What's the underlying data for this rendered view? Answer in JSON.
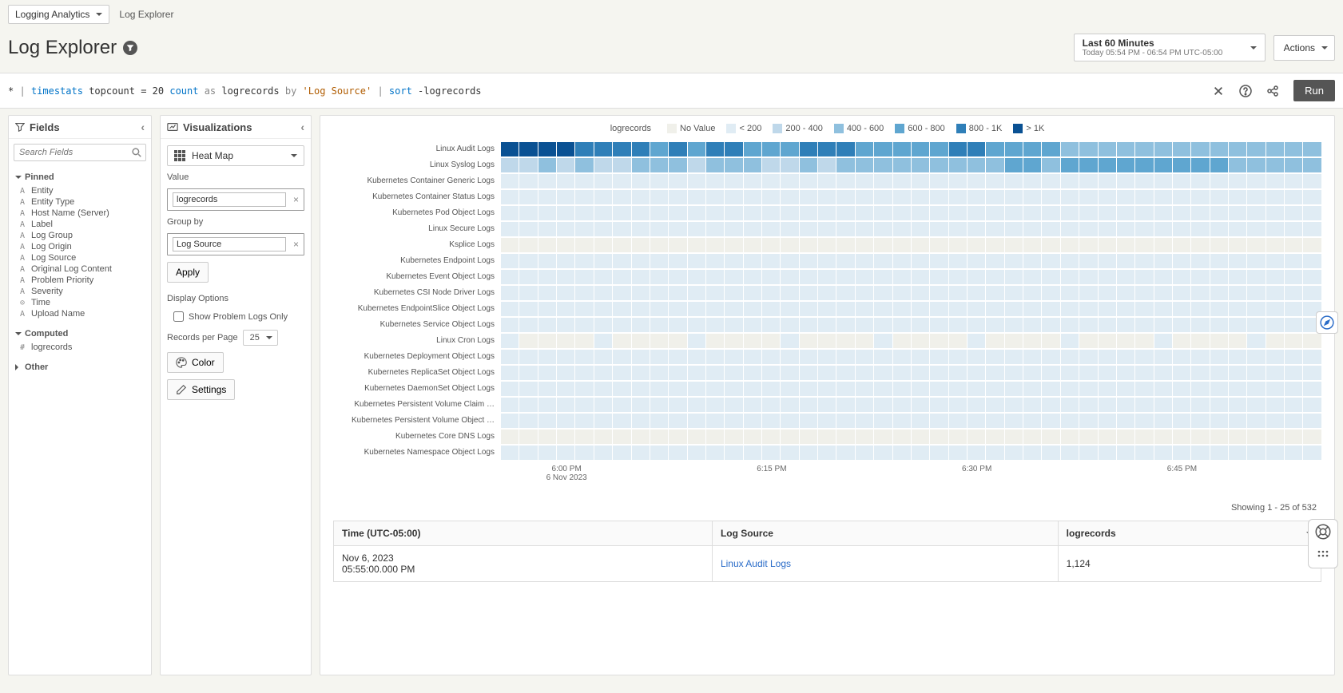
{
  "nav": {
    "dropdown": "Logging Analytics",
    "breadcrumb": "Log Explorer"
  },
  "title": "Log Explorer",
  "timerange": {
    "label": "Last 60 Minutes",
    "sub": "Today 05:54 PM - 06:54 PM UTC-05:00"
  },
  "actions_label": "Actions",
  "query": {
    "star": "*",
    "pipe1": "|",
    "cmd1": "timestats",
    "topcount": " topcount = 20 ",
    "count": "count",
    "as": " as ",
    "logrecords": "logrecords",
    "by": " by ",
    "source": "'Log Source'",
    "pipe2": " | ",
    "sort": "sort",
    "sortarg": " -logrecords"
  },
  "run_label": "Run",
  "fields": {
    "header": "Fields",
    "search_placeholder": "Search Fields",
    "pinned_label": "Pinned",
    "pinned": [
      {
        "p": "A",
        "name": "Entity"
      },
      {
        "p": "A",
        "name": "Entity Type"
      },
      {
        "p": "A",
        "name": "Host Name (Server)"
      },
      {
        "p": "A",
        "name": "Label"
      },
      {
        "p": "A",
        "name": "Log Group"
      },
      {
        "p": "A",
        "name": "Log Origin"
      },
      {
        "p": "A",
        "name": "Log Source"
      },
      {
        "p": "A",
        "name": "Original Log Content"
      },
      {
        "p": "A",
        "name": "Problem Priority"
      },
      {
        "p": "A",
        "name": "Severity"
      },
      {
        "p": "⊙",
        "name": "Time"
      },
      {
        "p": "A",
        "name": "Upload Name"
      }
    ],
    "computed_label": "Computed",
    "computed": [
      {
        "p": "#",
        "name": "logrecords"
      }
    ],
    "other_label": "Other"
  },
  "viz": {
    "header": "Visualizations",
    "type": "Heat Map",
    "value_label": "Value",
    "value": "logrecords",
    "group_label": "Group by",
    "group": "Log Source",
    "apply": "Apply",
    "display_options": "Display Options",
    "show_problem": "Show Problem Logs Only",
    "rpp_label": "Records per Page",
    "rpp": "25",
    "color": "Color",
    "settings": "Settings"
  },
  "legend": {
    "title": "logrecords",
    "items": [
      {
        "label": "No Value",
        "color": "#f0f0ea"
      },
      {
        "label": "< 200",
        "color": "#e0ecf4"
      },
      {
        "label": "200 - 400",
        "color": "#bfd8ea"
      },
      {
        "label": "400 - 600",
        "color": "#8fc0de"
      },
      {
        "label": "600 - 800",
        "color": "#5fa6d0"
      },
      {
        "label": "800 - 1K",
        "color": "#2f7fb8"
      },
      {
        "label": "> 1K",
        "color": "#0a5193"
      }
    ]
  },
  "chart_data": {
    "type": "heatmap",
    "title": "logrecords",
    "xlabel": "Time",
    "ylabel": "Log Source",
    "legend_position": "top",
    "n_x": 44,
    "x_start": "5:55 PM 6 Nov 2023",
    "x_end": "6:54 PM 6 Nov 2023",
    "x_ticks": [
      {
        "pos_pct": 8,
        "label": "6:00 PM",
        "sub": "6 Nov 2023"
      },
      {
        "pos_pct": 33,
        "label": "6:15 PM",
        "sub": ""
      },
      {
        "pos_pct": 58,
        "label": "6:30 PM",
        "sub": ""
      },
      {
        "pos_pct": 83,
        "label": "6:45 PM",
        "sub": ""
      }
    ],
    "color_bins": [
      {
        "label": "No Value",
        "color": "#f0f0ea",
        "range": [
          null,
          null
        ]
      },
      {
        "label": "< 200",
        "color": "#e0ecf4",
        "range": [
          0,
          200
        ]
      },
      {
        "label": "200 - 400",
        "color": "#bfd8ea",
        "range": [
          200,
          400
        ]
      },
      {
        "label": "400 - 600",
        "color": "#8fc0de",
        "range": [
          400,
          600
        ]
      },
      {
        "label": "600 - 800",
        "color": "#5fa6d0",
        "range": [
          600,
          800
        ]
      },
      {
        "label": "800 - 1K",
        "color": "#2f7fb8",
        "range": [
          800,
          1000
        ]
      },
      {
        "label": "> 1K",
        "color": "#0a5193",
        "range": [
          1000,
          null
        ]
      }
    ],
    "series": [
      {
        "name": "Linux Audit Logs",
        "row_bins": [
          6,
          6,
          6,
          6,
          5,
          5,
          5,
          5,
          4,
          5,
          4,
          5,
          5,
          4,
          4,
          4,
          5,
          5,
          5,
          4,
          4,
          4,
          4,
          4,
          5,
          5,
          4,
          4,
          4,
          4,
          3,
          3,
          3,
          3,
          3,
          3,
          3,
          3,
          3,
          3,
          3,
          3,
          3,
          3
        ]
      },
      {
        "name": "Linux Syslog Logs",
        "row_bins": [
          2,
          2,
          3,
          2,
          3,
          2,
          2,
          3,
          3,
          3,
          2,
          3,
          3,
          3,
          2,
          2,
          3,
          2,
          3,
          3,
          3,
          3,
          3,
          3,
          3,
          3,
          3,
          4,
          4,
          3,
          4,
          4,
          4,
          4,
          4,
          4,
          4,
          4,
          4,
          3,
          3,
          3,
          3,
          3
        ]
      },
      {
        "name": "Kubernetes Container Generic Logs",
        "row_bins": [
          1,
          1,
          1,
          1,
          1,
          1,
          1,
          1,
          1,
          1,
          1,
          1,
          1,
          1,
          1,
          1,
          1,
          1,
          1,
          1,
          1,
          1,
          1,
          1,
          1,
          1,
          1,
          1,
          1,
          1,
          1,
          1,
          1,
          1,
          1,
          1,
          1,
          1,
          1,
          1,
          1,
          1,
          1,
          1
        ]
      },
      {
        "name": "Kubernetes Container Status Logs",
        "row_bins": [
          1,
          1,
          1,
          1,
          1,
          1,
          1,
          1,
          1,
          1,
          1,
          1,
          1,
          1,
          1,
          1,
          1,
          1,
          1,
          1,
          1,
          1,
          1,
          1,
          1,
          1,
          1,
          1,
          1,
          1,
          1,
          1,
          1,
          1,
          1,
          1,
          1,
          1,
          1,
          1,
          1,
          1,
          1,
          1
        ]
      },
      {
        "name": "Kubernetes Pod Object Logs",
        "row_bins": [
          1,
          1,
          1,
          1,
          1,
          1,
          1,
          1,
          1,
          1,
          1,
          1,
          1,
          1,
          1,
          1,
          1,
          1,
          1,
          1,
          1,
          1,
          1,
          1,
          1,
          1,
          1,
          1,
          1,
          1,
          1,
          1,
          1,
          1,
          1,
          1,
          1,
          1,
          1,
          1,
          1,
          1,
          1,
          1
        ]
      },
      {
        "name": "Linux Secure Logs",
        "row_bins": [
          1,
          1,
          1,
          1,
          1,
          1,
          1,
          1,
          1,
          1,
          1,
          1,
          1,
          1,
          1,
          1,
          1,
          1,
          1,
          1,
          1,
          1,
          1,
          1,
          1,
          1,
          1,
          1,
          1,
          1,
          1,
          1,
          1,
          1,
          1,
          1,
          1,
          1,
          1,
          1,
          1,
          1,
          1,
          1
        ]
      },
      {
        "name": "Ksplice Logs",
        "row_bins": [
          0,
          0,
          0,
          0,
          0,
          0,
          0,
          0,
          0,
          0,
          0,
          0,
          0,
          0,
          0,
          0,
          0,
          0,
          0,
          0,
          0,
          0,
          0,
          0,
          0,
          0,
          0,
          0,
          0,
          0,
          0,
          0,
          0,
          0,
          0,
          0,
          0,
          0,
          0,
          0,
          0,
          0,
          0,
          0
        ]
      },
      {
        "name": "Kubernetes Endpoint Logs",
        "row_bins": [
          1,
          1,
          1,
          1,
          1,
          1,
          1,
          1,
          1,
          1,
          1,
          1,
          1,
          1,
          1,
          1,
          1,
          1,
          1,
          1,
          1,
          1,
          1,
          1,
          1,
          1,
          1,
          1,
          1,
          1,
          1,
          1,
          1,
          1,
          1,
          1,
          1,
          1,
          1,
          1,
          1,
          1,
          1,
          1
        ]
      },
      {
        "name": "Kubernetes Event Object Logs",
        "row_bins": [
          1,
          1,
          1,
          1,
          1,
          1,
          1,
          1,
          1,
          1,
          1,
          1,
          1,
          1,
          1,
          1,
          1,
          1,
          1,
          1,
          1,
          1,
          1,
          1,
          1,
          1,
          1,
          1,
          1,
          1,
          1,
          1,
          1,
          1,
          1,
          1,
          1,
          1,
          1,
          1,
          1,
          1,
          1,
          1
        ]
      },
      {
        "name": "Kubernetes CSI Node Driver Logs",
        "row_bins": [
          1,
          1,
          1,
          1,
          1,
          1,
          1,
          1,
          1,
          1,
          1,
          1,
          1,
          1,
          1,
          1,
          1,
          1,
          1,
          1,
          1,
          1,
          1,
          1,
          1,
          1,
          1,
          1,
          1,
          1,
          1,
          1,
          1,
          1,
          1,
          1,
          1,
          1,
          1,
          1,
          1,
          1,
          1,
          1
        ]
      },
      {
        "name": "Kubernetes EndpointSlice Object Logs",
        "row_bins": [
          1,
          1,
          1,
          1,
          1,
          1,
          1,
          1,
          1,
          1,
          1,
          1,
          1,
          1,
          1,
          1,
          1,
          1,
          1,
          1,
          1,
          1,
          1,
          1,
          1,
          1,
          1,
          1,
          1,
          1,
          1,
          1,
          1,
          1,
          1,
          1,
          1,
          1,
          1,
          1,
          1,
          1,
          1,
          1
        ]
      },
      {
        "name": "Kubernetes Service Object Logs",
        "row_bins": [
          1,
          1,
          1,
          1,
          1,
          1,
          1,
          1,
          1,
          1,
          1,
          1,
          1,
          1,
          1,
          1,
          1,
          1,
          1,
          1,
          1,
          1,
          1,
          1,
          1,
          1,
          1,
          1,
          1,
          1,
          1,
          1,
          1,
          1,
          1,
          1,
          1,
          1,
          1,
          1,
          1,
          1,
          1,
          1
        ]
      },
      {
        "name": "Linux Cron Logs",
        "row_bins": [
          1,
          0,
          0,
          0,
          0,
          1,
          0,
          0,
          0,
          0,
          1,
          0,
          0,
          0,
          0,
          1,
          0,
          0,
          0,
          0,
          1,
          0,
          0,
          0,
          0,
          1,
          0,
          0,
          0,
          0,
          1,
          0,
          0,
          0,
          0,
          1,
          0,
          0,
          0,
          0,
          1,
          0,
          0,
          0
        ]
      },
      {
        "name": "Kubernetes Deployment Object Logs",
        "row_bins": [
          1,
          1,
          1,
          1,
          1,
          1,
          1,
          1,
          1,
          1,
          1,
          1,
          1,
          1,
          1,
          1,
          1,
          1,
          1,
          1,
          1,
          1,
          1,
          1,
          1,
          1,
          1,
          1,
          1,
          1,
          1,
          1,
          1,
          1,
          1,
          1,
          1,
          1,
          1,
          1,
          1,
          1,
          1,
          1
        ]
      },
      {
        "name": "Kubernetes ReplicaSet Object Logs",
        "row_bins": [
          1,
          1,
          1,
          1,
          1,
          1,
          1,
          1,
          1,
          1,
          1,
          1,
          1,
          1,
          1,
          1,
          1,
          1,
          1,
          1,
          1,
          1,
          1,
          1,
          1,
          1,
          1,
          1,
          1,
          1,
          1,
          1,
          1,
          1,
          1,
          1,
          1,
          1,
          1,
          1,
          1,
          1,
          1,
          1
        ]
      },
      {
        "name": "Kubernetes DaemonSet Object Logs",
        "row_bins": [
          1,
          1,
          1,
          1,
          1,
          1,
          1,
          1,
          1,
          1,
          1,
          1,
          1,
          1,
          1,
          1,
          1,
          1,
          1,
          1,
          1,
          1,
          1,
          1,
          1,
          1,
          1,
          1,
          1,
          1,
          1,
          1,
          1,
          1,
          1,
          1,
          1,
          1,
          1,
          1,
          1,
          1,
          1,
          1
        ]
      },
      {
        "name": "Kubernetes Persistent Volume Claim …",
        "row_bins": [
          1,
          1,
          1,
          1,
          1,
          1,
          1,
          1,
          1,
          1,
          1,
          1,
          1,
          1,
          1,
          1,
          1,
          1,
          1,
          1,
          1,
          1,
          1,
          1,
          1,
          1,
          1,
          1,
          1,
          1,
          1,
          1,
          1,
          1,
          1,
          1,
          1,
          1,
          1,
          1,
          1,
          1,
          1,
          1
        ]
      },
      {
        "name": "Kubernetes Persistent Volume Object …",
        "row_bins": [
          1,
          1,
          1,
          1,
          1,
          1,
          1,
          1,
          1,
          1,
          1,
          1,
          1,
          1,
          1,
          1,
          1,
          1,
          1,
          1,
          1,
          1,
          1,
          1,
          1,
          1,
          1,
          1,
          1,
          1,
          1,
          1,
          1,
          1,
          1,
          1,
          1,
          1,
          1,
          1,
          1,
          1,
          1,
          1
        ]
      },
      {
        "name": "Kubernetes Core DNS Logs",
        "row_bins": [
          0,
          0,
          0,
          0,
          0,
          0,
          0,
          0,
          0,
          0,
          0,
          0,
          0,
          0,
          0,
          0,
          0,
          0,
          0,
          0,
          0,
          0,
          0,
          0,
          0,
          0,
          0,
          0,
          0,
          0,
          0,
          0,
          0,
          0,
          0,
          0,
          0,
          0,
          0,
          0,
          0,
          0,
          0,
          0
        ]
      },
      {
        "name": "Kubernetes Namespace Object Logs",
        "row_bins": [
          1,
          1,
          1,
          1,
          1,
          1,
          1,
          1,
          1,
          1,
          1,
          1,
          1,
          1,
          1,
          1,
          1,
          1,
          1,
          1,
          1,
          1,
          1,
          1,
          1,
          1,
          1,
          1,
          1,
          1,
          1,
          1,
          1,
          1,
          1,
          1,
          1,
          1,
          1,
          1,
          1,
          1,
          1,
          1
        ]
      }
    ]
  },
  "showing": "Showing 1 - 25 of 532",
  "table": {
    "cols": [
      "Time (UTC-05:00)",
      "Log Source",
      "logrecords"
    ],
    "rows": [
      {
        "time": "Nov 6, 2023\n05:55:00.000 PM",
        "source": "Linux Audit Logs",
        "logrecords": "1,124"
      }
    ]
  }
}
